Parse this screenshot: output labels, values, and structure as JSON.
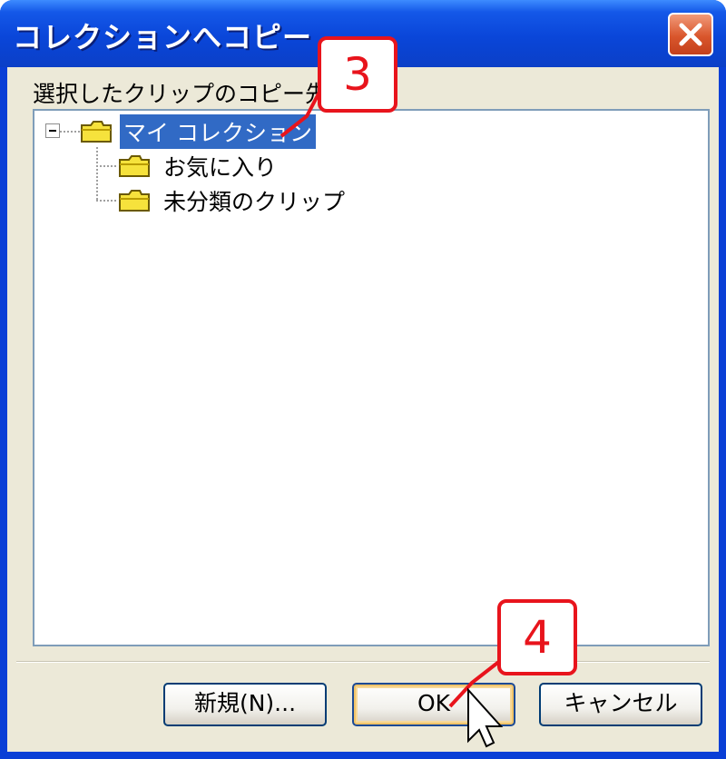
{
  "window": {
    "title": "コレクションへコピー",
    "close_icon": "close-icon"
  },
  "tree": {
    "label": "選択したクリップのコピー先",
    "root": {
      "label": "マイ コレクション",
      "expanded": true,
      "selected": true,
      "icon": "folder-icon"
    },
    "children": [
      {
        "label": "お気に入り",
        "icon": "folder-icon"
      },
      {
        "label": "未分類のクリップ",
        "icon": "folder-icon"
      }
    ]
  },
  "buttons": {
    "new_label": "新規(N)...",
    "ok_label": "OK",
    "cancel_label": "キャンセル"
  },
  "annotations": {
    "step3": "3",
    "step4": "4"
  },
  "colors": {
    "title_bar": "#0a46d9",
    "selection": "#316ac5",
    "callout": "#e8141c",
    "dialog_face": "#ece9d8"
  }
}
